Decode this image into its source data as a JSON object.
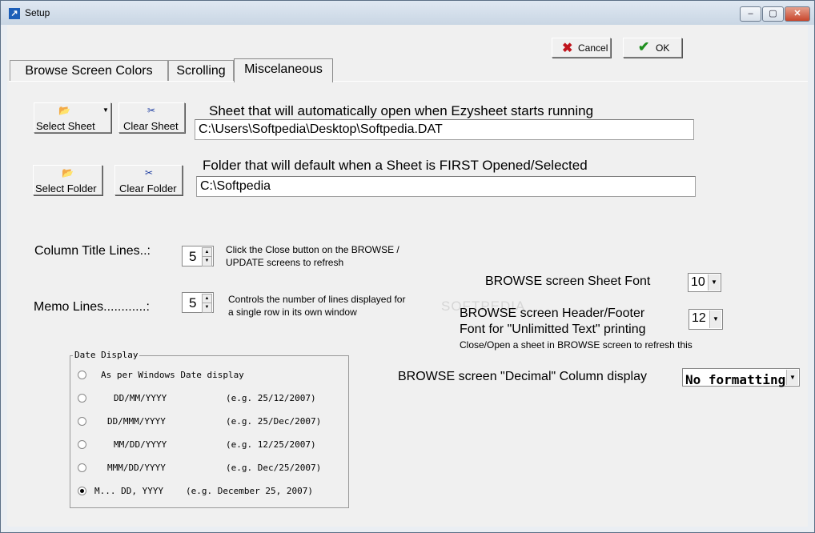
{
  "window": {
    "title": "Setup"
  },
  "titlebar_buttons": {
    "minimize": "–",
    "maximize": "▢",
    "close": "✕"
  },
  "toolbar": {
    "cancel_label": "Cancel",
    "ok_label": "OK"
  },
  "tabs": [
    "Browse Screen Colors",
    "Scrolling",
    "Miscelaneous"
  ],
  "sheet": {
    "select_label": "Select Sheet",
    "clear_label": "Clear Sheet",
    "heading": "Sheet that will automatically open when Ezysheet starts running",
    "value": "C:\\Users\\Softpedia\\Desktop\\Softpedia.DAT"
  },
  "folder": {
    "select_label": "Select Folder",
    "clear_label": "Clear Folder",
    "heading": "Folder that will default when a Sheet is FIRST Opened/Selected",
    "value": "C:\\Softpedia"
  },
  "column_title": {
    "label": "Column Title Lines..:",
    "value": "5",
    "hint_line1": "Click the Close button on the BROWSE /",
    "hint_line2": "UPDATE screens to refresh"
  },
  "memo": {
    "label": "Memo Lines............:",
    "value": "5",
    "hint_line1": "Controls the number of lines displayed for",
    "hint_line2": "a single row in its own window"
  },
  "sheet_font": {
    "label": "BROWSE screen Sheet Font",
    "value": "10"
  },
  "header_font": {
    "label_line1": "BROWSE screen Header/Footer",
    "label_line2": "Font for \"Unlimitted Text\" printing",
    "value": "12",
    "hint": "Close/Open a sheet in BROWSE screen to refresh this"
  },
  "decimal": {
    "label": "BROWSE screen \"Decimal\" Column display",
    "value": "No formatting"
  },
  "date_display": {
    "title": "Date Display",
    "options": [
      {
        "format": "As per Windows Date display",
        "example": ""
      },
      {
        "format": "DD/MM/YYYY",
        "example": "(e.g.  25/12/2007)"
      },
      {
        "format": "DD/MMM/YYYY",
        "example": "(e.g. 25/Dec/2007)"
      },
      {
        "format": "MM/DD/YYYY",
        "example": "(e.g.  12/25/2007)"
      },
      {
        "format": "MMM/DD/YYYY",
        "example": "(e.g. Dec/25/2007)"
      },
      {
        "format": "M... DD, YYYY",
        "example": "(e.g. December 25, 2007)"
      }
    ],
    "selected_index": 5
  },
  "watermark": "SOFTPEDIA",
  "colors": {
    "cancel_icon": "#c0141c",
    "ok_icon": "#1e8f1e"
  }
}
